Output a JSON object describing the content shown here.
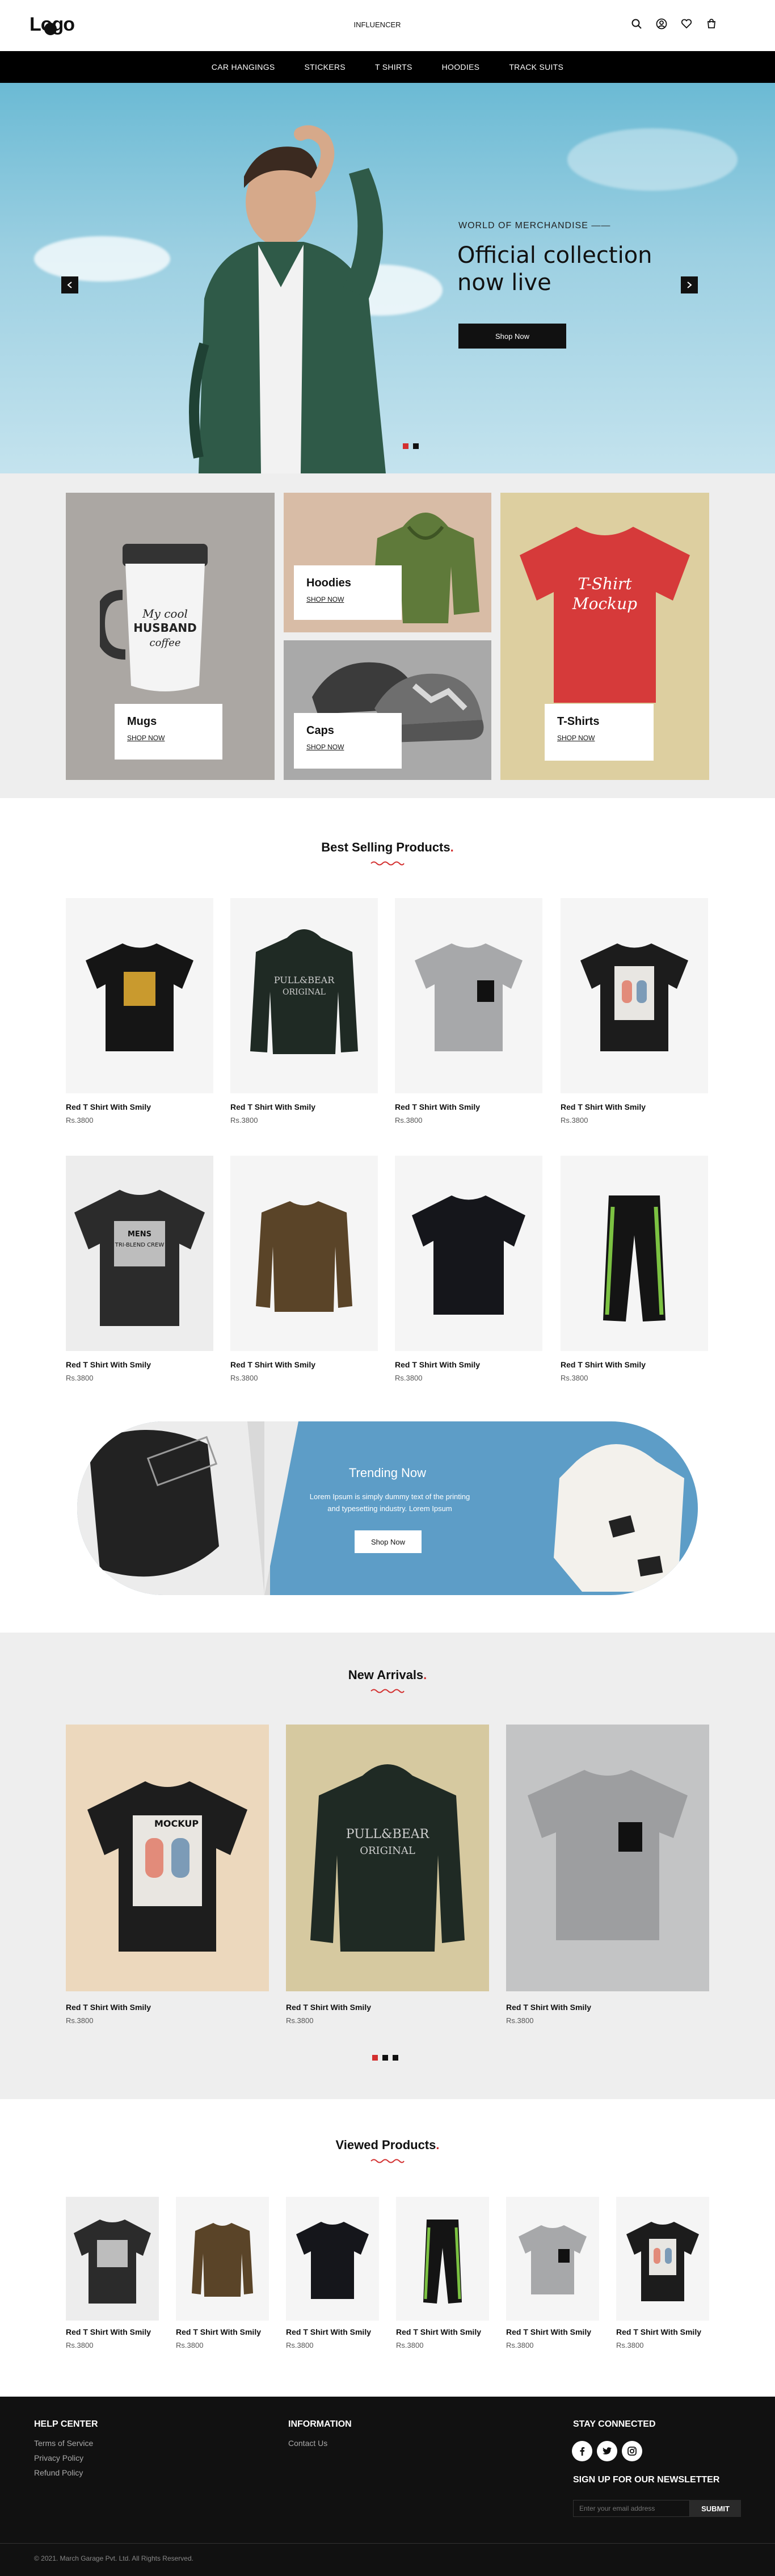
{
  "header": {
    "logo_text": "Logo",
    "brand": "INFLUENCER",
    "icons": [
      "search-icon",
      "user-icon",
      "heart-icon",
      "cart-icon"
    ]
  },
  "nav": {
    "items": [
      {
        "label": "CAR HANGINGS"
      },
      {
        "label": "STICKERS"
      },
      {
        "label": "T SHIRTS"
      },
      {
        "label": "HOODIES"
      },
      {
        "label": "TRACK SUITS"
      }
    ]
  },
  "hero": {
    "kicker": "WORLD OF MERCHANDISE ——",
    "title": "Official collection now live",
    "button": "Shop Now",
    "slide_count": 2,
    "active_slide": 1
  },
  "categories": [
    {
      "name": "Mugs",
      "link": "SHOP NOW"
    },
    {
      "name": "Hoodies",
      "link": "SHOP NOW"
    },
    {
      "name": "Caps",
      "link": "SHOP NOW"
    },
    {
      "name": "T-Shirts",
      "link": "SHOP NOW"
    }
  ],
  "best_selling": {
    "title": "Best Selling Products",
    "products": [
      {
        "name": "Red T Shirt With Smily",
        "price": "Rs.3800"
      },
      {
        "name": "Red T Shirt With Smily",
        "price": "Rs.3800"
      },
      {
        "name": "Red T Shirt With Smily",
        "price": "Rs.3800"
      },
      {
        "name": "Red T Shirt With Smily",
        "price": "Rs.3800"
      },
      {
        "name": "Red T Shirt With Smily",
        "price": "Rs.3800"
      },
      {
        "name": "Red T Shirt With Smily",
        "price": "Rs.3800"
      },
      {
        "name": "Red T Shirt With Smily",
        "price": "Rs.3800"
      },
      {
        "name": "Red T Shirt With Smily",
        "price": "Rs.3800"
      }
    ]
  },
  "trending": {
    "title": "Trending Now",
    "text": "Lorem Ipsum is simply dummy text of the printing and typesetting industry. Lorem Ipsum",
    "button": "Shop Now"
  },
  "new_arrivals": {
    "title": "New Arrivals",
    "products": [
      {
        "name": "Red T Shirt With Smily",
        "price": "Rs.3800"
      },
      {
        "name": "Red T Shirt With Smily",
        "price": "Rs.3800"
      },
      {
        "name": "Red T Shirt With Smily",
        "price": "Rs.3800"
      }
    ],
    "slide_count": 3,
    "active_slide": 1
  },
  "viewed": {
    "title": "Viewed Products",
    "products": [
      {
        "name": "Red T Shirt With Smily",
        "price": "Rs.3800"
      },
      {
        "name": "Red T Shirt With Smily",
        "price": "Rs.3800"
      },
      {
        "name": "Red T Shirt With Smily",
        "price": "Rs.3800"
      },
      {
        "name": "Red T Shirt With Smily",
        "price": "Rs.3800"
      },
      {
        "name": "Red T Shirt With Smily",
        "price": "Rs.3800"
      },
      {
        "name": "Red T Shirt With Smily",
        "price": "Rs.3800"
      }
    ]
  },
  "footer": {
    "help_title": "HELP CENTER",
    "help_links": [
      "Terms of Service",
      "Privacy Policy",
      "Refund Policy"
    ],
    "info_title": "INFORMATION",
    "info_links": [
      "Contact Us"
    ],
    "connect_title": "STAY CONNECTED",
    "social": [
      "facebook-icon",
      "twitter-icon",
      "instagram-icon"
    ],
    "newsletter_title": "SIGN UP FOR OUR NEWSLETTER",
    "email_placeholder": "Enter your email address",
    "submit": "SUBMIT",
    "copyright": "© 2021. March Garage Pvt. Ltd. All Rights Reserved."
  },
  "colors": {
    "accent": "#d32f2f",
    "nav_bg": "#000000",
    "hero_sky": "#8ccbe0",
    "trending_blue": "#5d9dc7",
    "footer_bg": "#111111"
  }
}
